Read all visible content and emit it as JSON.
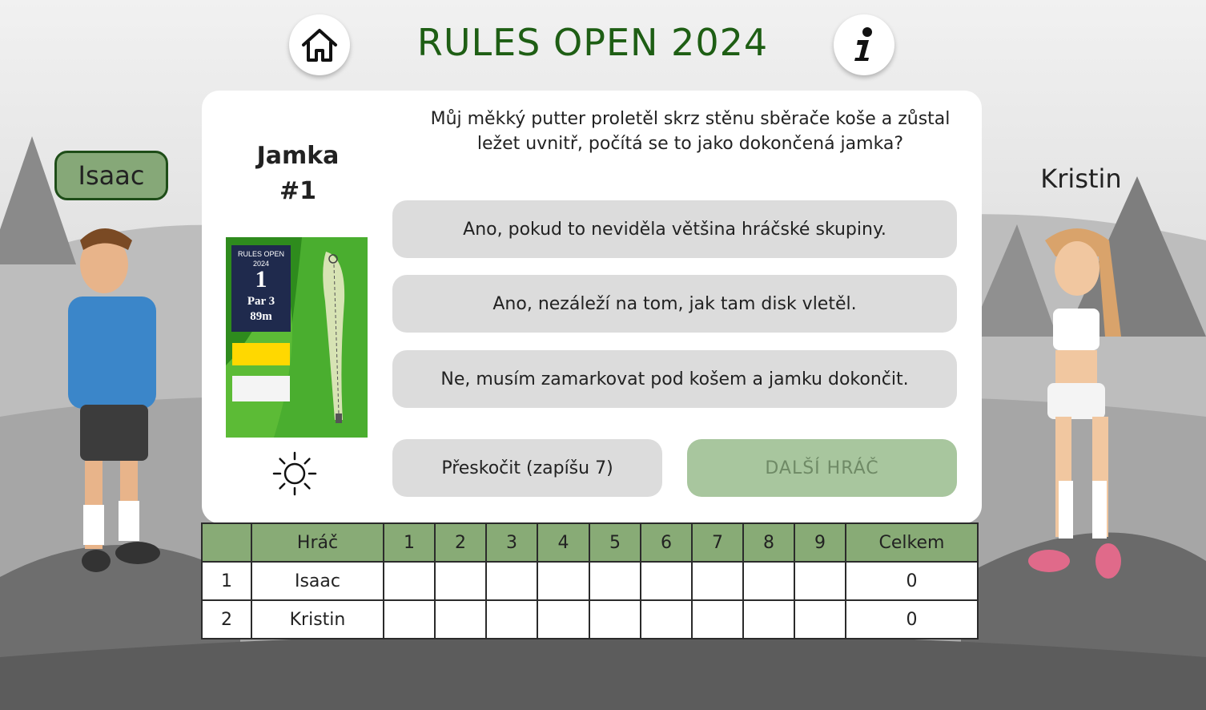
{
  "header": {
    "title": "RULES OPEN 2024",
    "home_icon": "home-icon",
    "info_icon": "info-icon"
  },
  "players": {
    "left": {
      "name": "Isaac"
    },
    "right": {
      "name": "Kristin"
    }
  },
  "hole": {
    "title_line1": "Jamka",
    "title_line2": "#1",
    "card": {
      "event_line1": "RULES OPEN",
      "event_line2": "2024",
      "number": "1",
      "par": "Par 3",
      "distance": "89m"
    },
    "weather_icon": "sun-icon"
  },
  "question": {
    "text": "Můj měkký putter proletěl skrz stěnu sběrače koše a zůstal ležet uvnitř, počítá se to jako dokončená jamka?",
    "answers": [
      "Ano, pokud to neviděla většina hráčské skupiny.",
      "Ano, nezáleží na tom, jak tam disk vletěl.",
      "Ne, musím zamarkovat pod košem a jamku dokončit."
    ]
  },
  "actions": {
    "skip": "Přeskočit (zapíšu 7)",
    "next": "DALŠÍ HRÁČ"
  },
  "scoreboard": {
    "headers": [
      "",
      "Hráč",
      "1",
      "2",
      "3",
      "4",
      "5",
      "6",
      "7",
      "8",
      "9",
      "Celkem"
    ],
    "rows": [
      {
        "index": "1",
        "name": "Isaac",
        "total": "0"
      },
      {
        "index": "2",
        "name": "Kristin",
        "total": "0"
      }
    ]
  },
  "colors": {
    "accent": "#1e5e14",
    "header_row": "#88ab76",
    "next_button": "#a8c69e"
  }
}
